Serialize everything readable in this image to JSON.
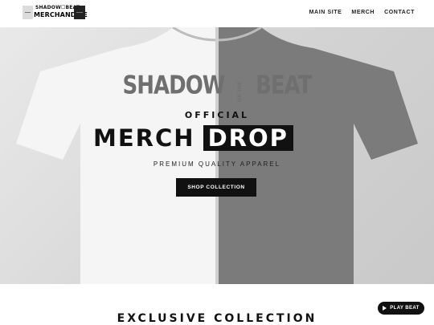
{
  "header": {
    "logo": {
      "line1": "SHADOW☐BEAT",
      "line2": "MERCHANDISE",
      "icon_left": "merch-tag-icon",
      "icon_right": "merch-tag-icon"
    },
    "nav": [
      {
        "label": "MAIN SITE"
      },
      {
        "label": "MERCH"
      },
      {
        "label": "CONTACT"
      }
    ]
  },
  "hero": {
    "brand_left": "SHADOW",
    "brand_middle": "ON THE",
    "brand_right": "BEAT",
    "official": "OFFICIAL",
    "headline_part1": "MERCH",
    "headline_part2": "DROP",
    "subtitle": "PREMIUM QUALITY APPAREL",
    "cta": "SHOP COLLECTION",
    "colors": {
      "left_shirt": "#f4f4f4",
      "right_shirt": "#7a7a7a",
      "cta_bg": "#111111"
    }
  },
  "section": {
    "title": "EXCLUSIVE COLLECTION"
  },
  "player": {
    "label": "PLAY BEAT",
    "icon": "play-icon"
  }
}
